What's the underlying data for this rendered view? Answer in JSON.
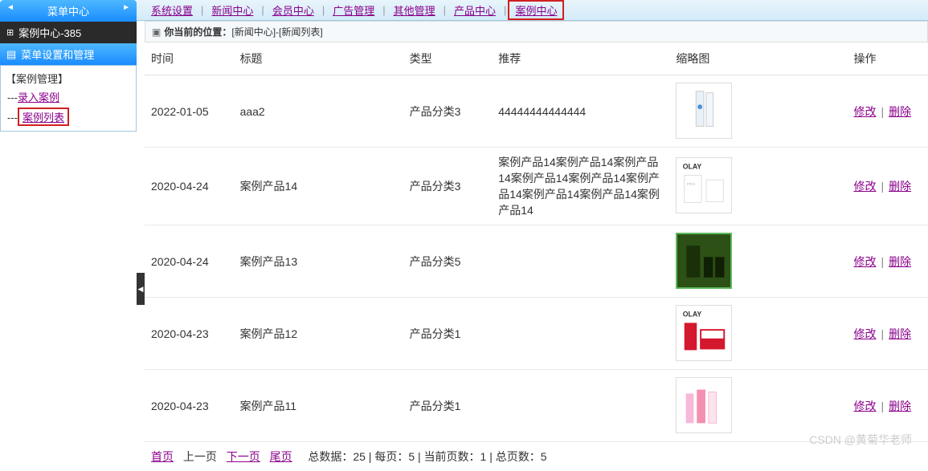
{
  "topnav": {
    "items": [
      "系统设置",
      "新闻中心",
      "会员中心",
      "广告管理",
      "其他管理",
      "产品中心",
      "案例中心"
    ],
    "highlighted_index": 6
  },
  "sidebar": {
    "title": "菜单中心",
    "subtitle": "案例中心-385",
    "menu_header": "菜单设置和管理",
    "group_label": "【案例管理】",
    "items": [
      {
        "prefix": "---",
        "label": "录入案例",
        "highlighted": false
      },
      {
        "prefix": "---",
        "label": "案例列表",
        "highlighted": true
      }
    ]
  },
  "breadcrumb": {
    "label": "你当前的位置：",
    "path": "[新闻中心]-[新闻列表]"
  },
  "table": {
    "headers": {
      "time": "时间",
      "title": "标题",
      "type": "类型",
      "recommend": "推荐",
      "thumb": "缩略图",
      "action": "操作"
    },
    "rows": [
      {
        "time": "2022-01-05",
        "title": "aaa2",
        "type": "产品分类3",
        "recommend": "44444444444444",
        "thumb": "cosmetic1"
      },
      {
        "time": "2020-04-24",
        "title": "案例产品14",
        "type": "产品分类3",
        "recommend": "案例产品14案例产品14案例产品14案例产品14案例产品14案例产品14案例产品14案例产品14案例产品14",
        "thumb": "olay1"
      },
      {
        "time": "2020-04-24",
        "title": "案例产品13",
        "type": "产品分类5",
        "recommend": "",
        "thumb": "green"
      },
      {
        "time": "2020-04-23",
        "title": "案例产品12",
        "type": "产品分类1",
        "recommend": "",
        "thumb": "olay2"
      },
      {
        "time": "2020-04-23",
        "title": "案例产品11",
        "type": "产品分类1",
        "recommend": "",
        "thumb": "pink"
      }
    ],
    "actions": {
      "edit": "修改",
      "delete": "删除"
    }
  },
  "pagination": {
    "first": "首页",
    "prev": "上一页",
    "next": "下一页",
    "last": "尾页",
    "stats": "总数据：25 | 每页：5 | 当前页数：1 | 总页数：5"
  },
  "watermark": "CSDN @黄菊华老师"
}
